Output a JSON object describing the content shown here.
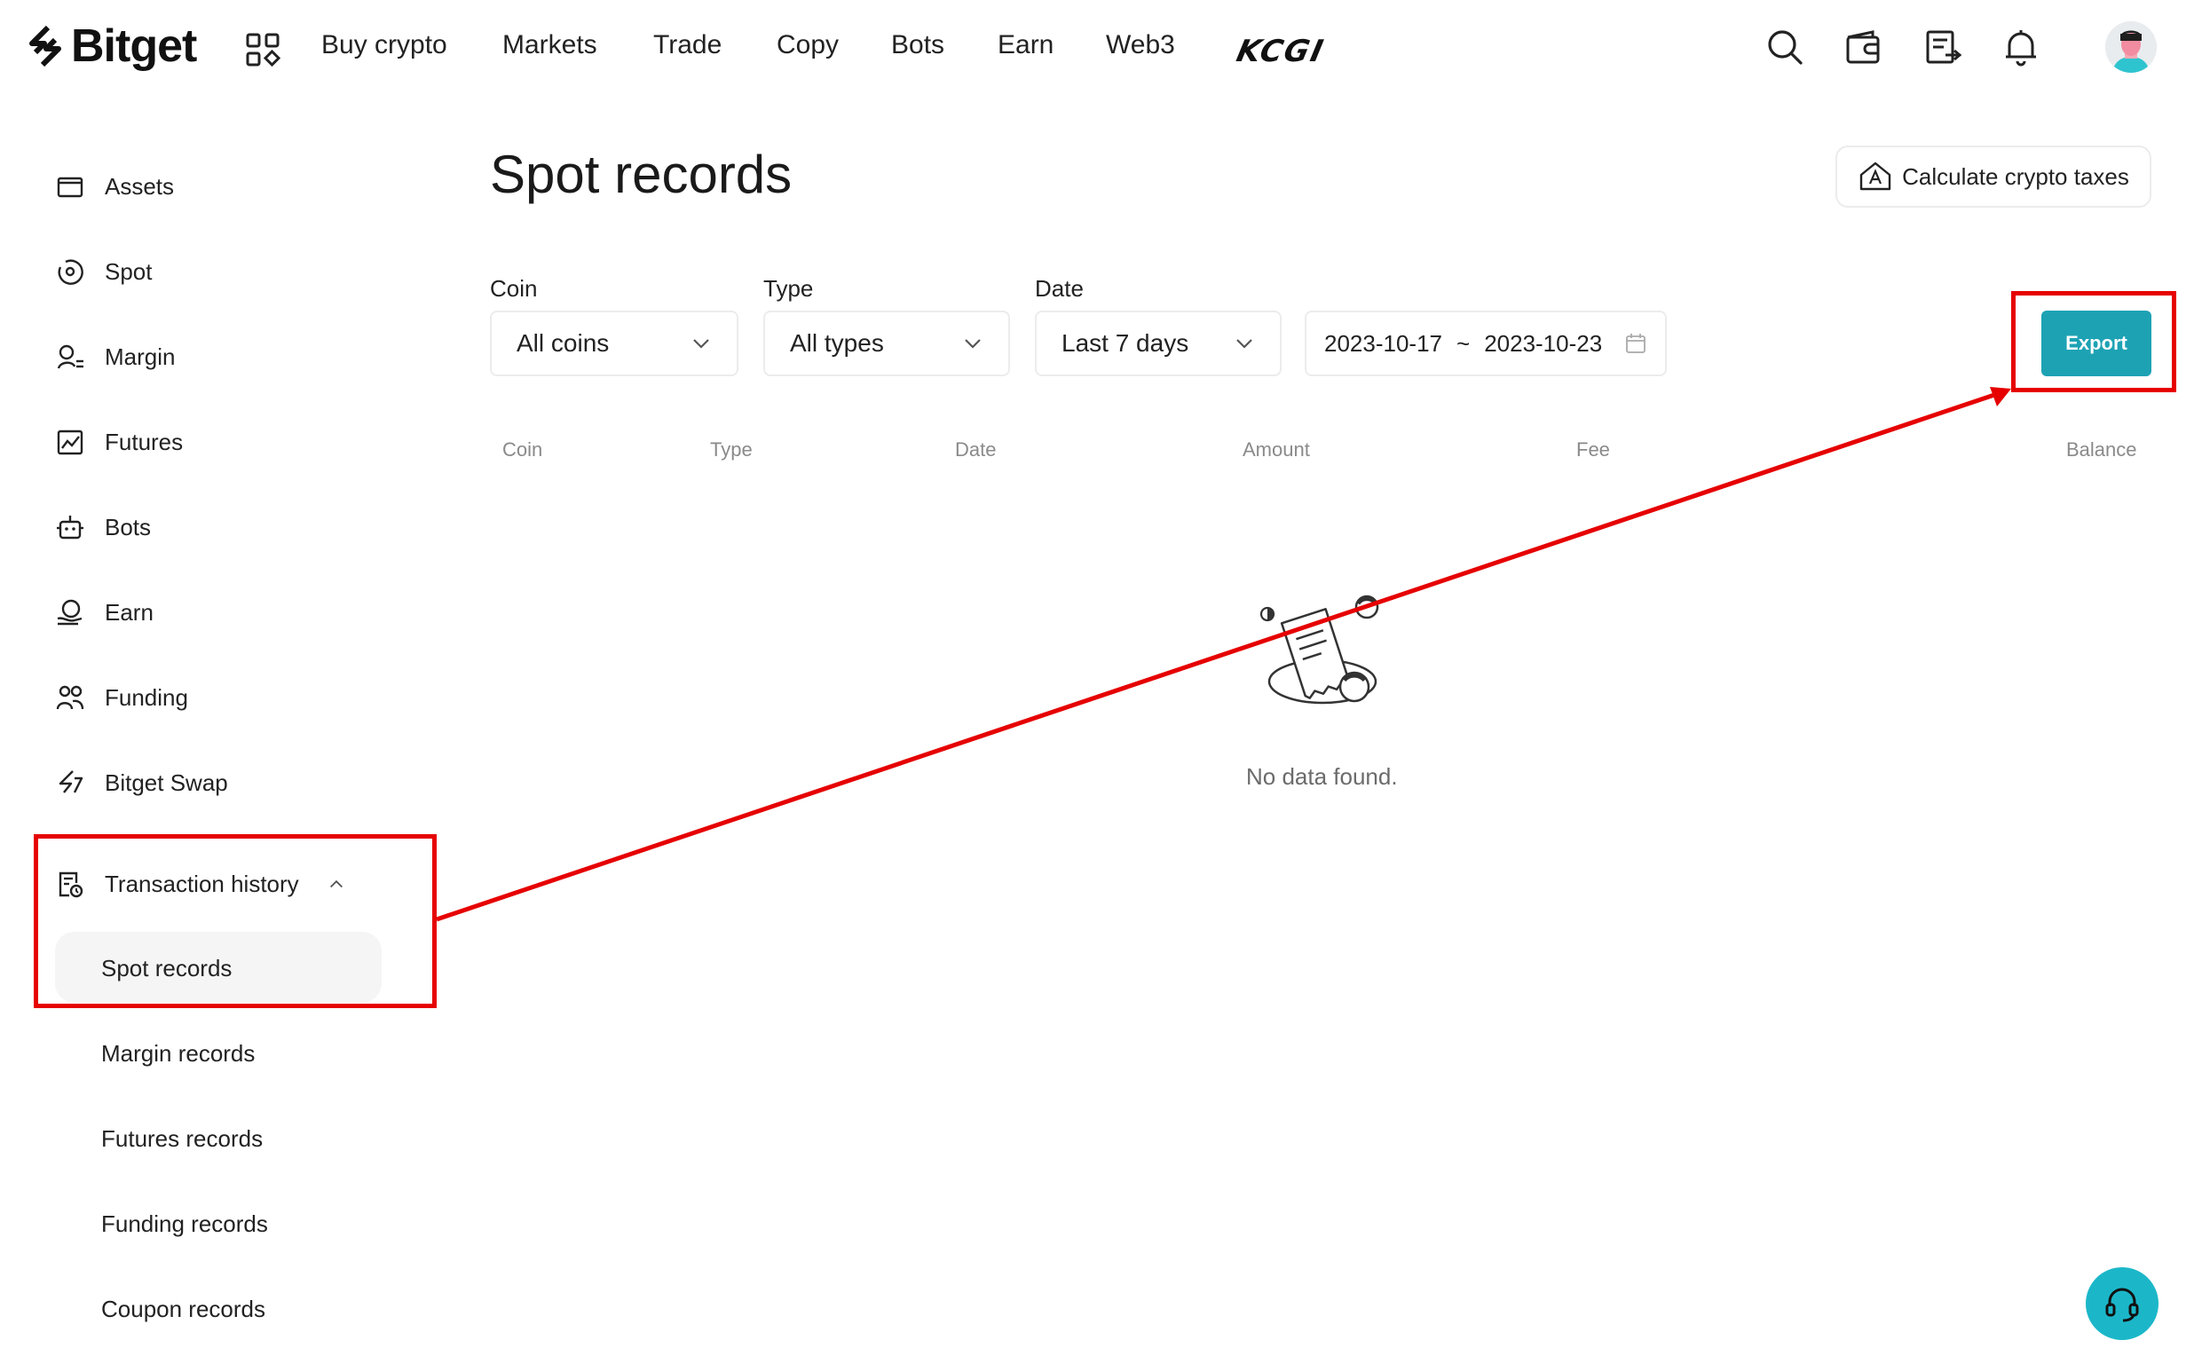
{
  "brand": {
    "name": "Bitget"
  },
  "nav": {
    "items": [
      "Buy crypto",
      "Markets",
      "Trade",
      "Copy",
      "Bots",
      "Earn",
      "Web3"
    ],
    "promo": "KCGI"
  },
  "sidebar": {
    "items": [
      {
        "label": "Assets",
        "icon": "wallet-icon"
      },
      {
        "label": "Spot",
        "icon": "spot-icon"
      },
      {
        "label": "Margin",
        "icon": "margin-icon"
      },
      {
        "label": "Futures",
        "icon": "futures-icon"
      },
      {
        "label": "Bots",
        "icon": "robot-icon"
      },
      {
        "label": "Earn",
        "icon": "earn-icon"
      },
      {
        "label": "Funding",
        "icon": "people-icon"
      },
      {
        "label": "Bitget Swap",
        "icon": "swap-icon"
      }
    ],
    "transaction_history": {
      "label": "Transaction history",
      "sub_items": [
        "Spot records",
        "Margin records",
        "Futures records",
        "Funding records",
        "Coupon records"
      ],
      "active": "Spot records"
    }
  },
  "main": {
    "title": "Spot records",
    "tax_button": "Calculate crypto taxes",
    "filters": {
      "coin": {
        "label": "Coin",
        "value": "All coins"
      },
      "type": {
        "label": "Type",
        "value": "All types"
      },
      "date": {
        "label": "Date",
        "value": "Last 7 days"
      },
      "range_start": "2023-10-17",
      "range_sep": "~",
      "range_end": "2023-10-23"
    },
    "export_label": "Export",
    "columns": [
      "Coin",
      "Type",
      "Date",
      "Amount",
      "Fee",
      "Balance"
    ],
    "empty_text": "No data found."
  },
  "colors": {
    "accent": "#1da2b4",
    "annotation": "#e60000",
    "support": "#1bb7c9"
  }
}
